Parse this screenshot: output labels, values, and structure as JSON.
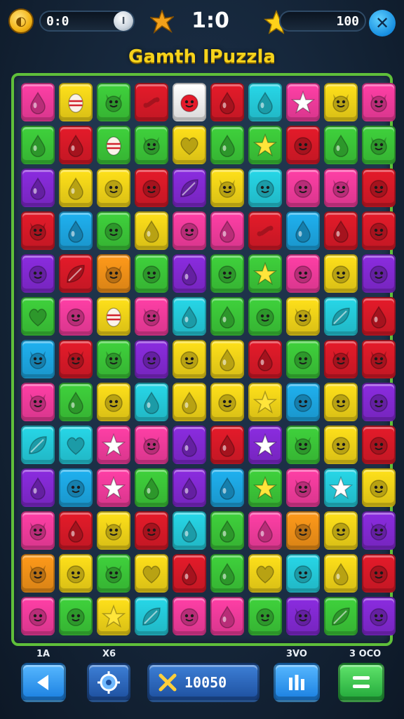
{
  "hud": {
    "left_counter": "0:0",
    "center_score": "1:0",
    "right_counter": "100"
  },
  "title": "Gamth IPuzzla",
  "bottom": {
    "label_1": "1A",
    "label_2": "X6",
    "label_3": "3VO",
    "label_4": "3 OCO",
    "score_button_text": "10050"
  },
  "colors": {
    "red": "#e51b2a",
    "green": "#3fd23c",
    "yellow": "#ffe11a",
    "blue": "#1fb1f0",
    "purple": "#8b2ce0",
    "pink": "#ff3fa6",
    "orange": "#ff9a1a",
    "cyan": "#27d7e8",
    "lightpink": "#ff8fd0",
    "lime": "#9ae52b"
  },
  "board": {
    "rows": [
      [
        [
          "pink",
          "drop-icon"
        ],
        [
          "yellow",
          "egg-icon"
        ],
        [
          "green",
          "cat-face-icon"
        ],
        [
          "red",
          "bone-icon"
        ],
        [
          "white",
          "smiley-face-icon"
        ],
        [
          "red",
          "drop-icon"
        ],
        [
          "cyan",
          "drop-icon"
        ],
        [
          "pink",
          "star-icon"
        ],
        [
          "yellow",
          "cat-face-icon"
        ],
        [
          "pink",
          "cat-face-icon"
        ]
      ],
      [
        [
          "green",
          "drop-icon"
        ],
        [
          "red",
          "drop-icon"
        ],
        [
          "green",
          "egg-icon"
        ],
        [
          "green",
          "cat-face-icon"
        ],
        [
          "yellow",
          "heart-icon"
        ],
        [
          "green",
          "drop-icon"
        ],
        [
          "green",
          "star-icon"
        ],
        [
          "red",
          "smiley-face-icon"
        ],
        [
          "green",
          "drop-icon"
        ],
        [
          "green",
          "cat-face-icon"
        ]
      ],
      [
        [
          "purple",
          "drop-icon"
        ],
        [
          "yellow",
          "drop-icon"
        ],
        [
          "yellow",
          "smiley-face-icon"
        ],
        [
          "red",
          "smiley-face-icon"
        ],
        [
          "purple",
          "leaf-icon"
        ],
        [
          "yellow",
          "cat-face-icon"
        ],
        [
          "cyan",
          "smiley-face-icon"
        ],
        [
          "pink",
          "smiley-face-icon"
        ],
        [
          "pink",
          "cat-face-icon"
        ],
        [
          "red",
          "smiley-face-icon"
        ]
      ],
      [
        [
          "red",
          "cat-face-icon"
        ],
        [
          "blue",
          "drop-icon"
        ],
        [
          "green",
          "smiley-face-icon"
        ],
        [
          "yellow",
          "drop-icon"
        ],
        [
          "pink",
          "smiley-face-icon"
        ],
        [
          "pink",
          "drop-icon"
        ],
        [
          "red",
          "bone-icon"
        ],
        [
          "blue",
          "drop-icon"
        ],
        [
          "red",
          "drop-icon"
        ],
        [
          "red",
          "smiley-face-icon"
        ]
      ],
      [
        [
          "purple",
          "smiley-face-icon"
        ],
        [
          "red",
          "leaf-icon"
        ],
        [
          "orange",
          "cat-face-icon"
        ],
        [
          "green",
          "smiley-face-icon"
        ],
        [
          "purple",
          "drop-icon"
        ],
        [
          "green",
          "smiley-face-icon"
        ],
        [
          "green",
          "star-icon"
        ],
        [
          "pink",
          "smiley-face-icon"
        ],
        [
          "yellow",
          "smiley-face-icon"
        ],
        [
          "purple",
          "smiley-face-icon"
        ]
      ],
      [
        [
          "green",
          "heart-icon"
        ],
        [
          "pink",
          "smiley-face-icon"
        ],
        [
          "yellow",
          "egg-icon"
        ],
        [
          "pink",
          "cat-face-icon"
        ],
        [
          "cyan",
          "drop-icon"
        ],
        [
          "green",
          "drop-icon"
        ],
        [
          "green",
          "smiley-face-icon"
        ],
        [
          "yellow",
          "cat-face-icon"
        ],
        [
          "cyan",
          "leaf-icon"
        ],
        [
          "red",
          "drop-icon"
        ]
      ],
      [
        [
          "blue",
          "cat-face-icon"
        ],
        [
          "red",
          "cat-face-icon"
        ],
        [
          "green",
          "cat-face-icon"
        ],
        [
          "purple",
          "smiley-face-icon"
        ],
        [
          "yellow",
          "smiley-face-icon"
        ],
        [
          "yellow",
          "drop-icon"
        ],
        [
          "red",
          "drop-icon"
        ],
        [
          "green",
          "smiley-face-icon"
        ],
        [
          "red",
          "cat-face-icon"
        ],
        [
          "red",
          "cat-face-icon"
        ]
      ],
      [
        [
          "pink",
          "cat-face-icon"
        ],
        [
          "green",
          "drop-icon"
        ],
        [
          "yellow",
          "smiley-face-icon"
        ],
        [
          "cyan",
          "drop-icon"
        ],
        [
          "yellow",
          "drop-icon"
        ],
        [
          "yellow",
          "smiley-face-icon"
        ],
        [
          "yellow",
          "star-icon"
        ],
        [
          "blue",
          "smiley-face-icon"
        ],
        [
          "yellow",
          "smiley-face-icon"
        ],
        [
          "purple",
          "smiley-face-icon"
        ]
      ],
      [
        [
          "cyan",
          "leaf-icon"
        ],
        [
          "cyan",
          "heart-icon"
        ],
        [
          "pink",
          "star-icon"
        ],
        [
          "pink",
          "cat-face-icon"
        ],
        [
          "purple",
          "drop-icon"
        ],
        [
          "red",
          "drop-icon"
        ],
        [
          "purple",
          "star-icon"
        ],
        [
          "green",
          "cat-face-icon"
        ],
        [
          "yellow",
          "smiley-face-icon"
        ],
        [
          "red",
          "smiley-face-icon"
        ]
      ],
      [
        [
          "purple",
          "drop-icon"
        ],
        [
          "blue",
          "smiley-face-icon"
        ],
        [
          "pink",
          "star-icon"
        ],
        [
          "green",
          "drop-icon"
        ],
        [
          "purple",
          "drop-icon"
        ],
        [
          "blue",
          "drop-icon"
        ],
        [
          "green",
          "star-icon"
        ],
        [
          "pink",
          "cat-face-icon"
        ],
        [
          "cyan",
          "star-icon"
        ],
        [
          "yellow",
          "smiley-face-icon"
        ]
      ],
      [
        [
          "pink",
          "cat-face-icon"
        ],
        [
          "red",
          "drop-icon"
        ],
        [
          "yellow",
          "cat-face-icon"
        ],
        [
          "red",
          "smiley-face-icon"
        ],
        [
          "cyan",
          "drop-icon"
        ],
        [
          "green",
          "drop-icon"
        ],
        [
          "pink",
          "drop-icon"
        ],
        [
          "orange",
          "cat-face-icon"
        ],
        [
          "yellow",
          "smiley-face-icon"
        ],
        [
          "purple",
          "cat-face-icon"
        ]
      ],
      [
        [
          "orange",
          "cat-face-icon"
        ],
        [
          "yellow",
          "smiley-face-icon"
        ],
        [
          "green",
          "cat-face-icon"
        ],
        [
          "yellow",
          "heart-icon"
        ],
        [
          "red",
          "drop-icon"
        ],
        [
          "green",
          "drop-icon"
        ],
        [
          "yellow",
          "heart-icon"
        ],
        [
          "cyan",
          "smiley-face-icon"
        ],
        [
          "yellow",
          "drop-icon"
        ],
        [
          "red",
          "smiley-face-icon"
        ]
      ],
      [
        [
          "pink",
          "smiley-face-icon"
        ],
        [
          "green",
          "smiley-face-icon"
        ],
        [
          "yellow",
          "star-icon"
        ],
        [
          "cyan",
          "leaf-icon"
        ],
        [
          "pink",
          "smiley-face-icon"
        ],
        [
          "pink",
          "drop-icon"
        ],
        [
          "green",
          "smiley-face-icon"
        ],
        [
          "purple",
          "cat-face-icon"
        ],
        [
          "green",
          "leaf-icon"
        ],
        [
          "purple",
          "smiley-face-icon"
        ]
      ]
    ]
  }
}
